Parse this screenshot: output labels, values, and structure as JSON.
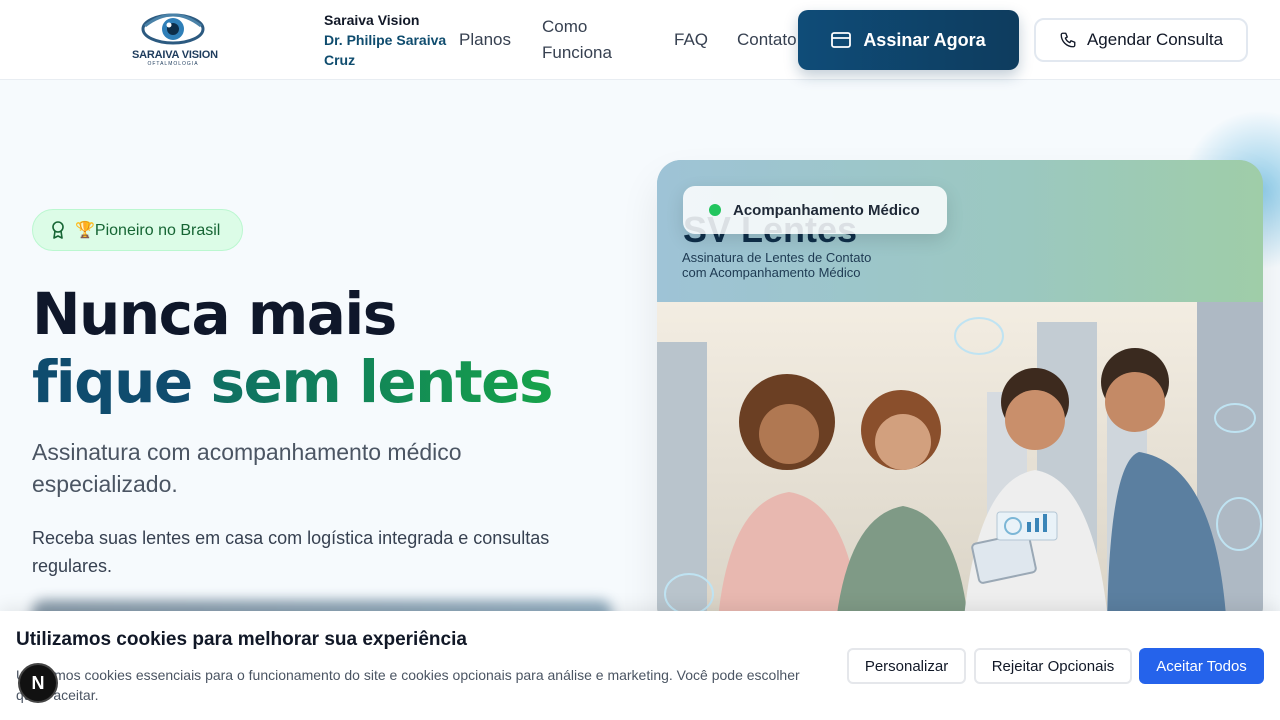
{
  "header": {
    "logo_text": "SARAIVA VISION",
    "logo_sub": "OFTALMOLOGIA",
    "brand_name": "Saraiva Vision",
    "brand_doctor": "Dr. Philipe Saraiva Cruz",
    "nav": {
      "planos": "Planos",
      "como_funciona": "Como Funciona",
      "faq": "FAQ",
      "contato": "Contato"
    },
    "assinar_label": "Assinar Agora",
    "agendar_label": "Agendar Consulta"
  },
  "hero": {
    "badge": "🏆Pioneiro no Brasil",
    "headline_line1": "Nunca mais",
    "headline_line2_a": "fique ",
    "headline_line2_b": "sem lentes",
    "subtitle": "Assinatura com acompanhamento médico especializado.",
    "description": "Receba suas lentes em casa com logística integrada e consultas regulares."
  },
  "card": {
    "title": "SV Lentes",
    "subtitle_line1": "Assinatura de Lentes de Contato",
    "subtitle_line2": "com Acompanhamento Médico",
    "pill_label": "Acompanhamento Médico"
  },
  "cookie": {
    "title": "Utilizamos cookies para melhorar sua experiência",
    "text": "Utilizamos cookies essenciais para o funcionamento do site e cookies opcionais para análise e marketing. Você pode escolher quais aceitar.",
    "personalizar": "Personalizar",
    "rejeitar": "Rejeitar Opcionais",
    "aceitar": "Aceitar Todos"
  },
  "dev_badge": "N",
  "colors": {
    "primary": "#0e3c5e",
    "accent_green": "#16a34a",
    "cookie_accept": "#2563eb"
  }
}
